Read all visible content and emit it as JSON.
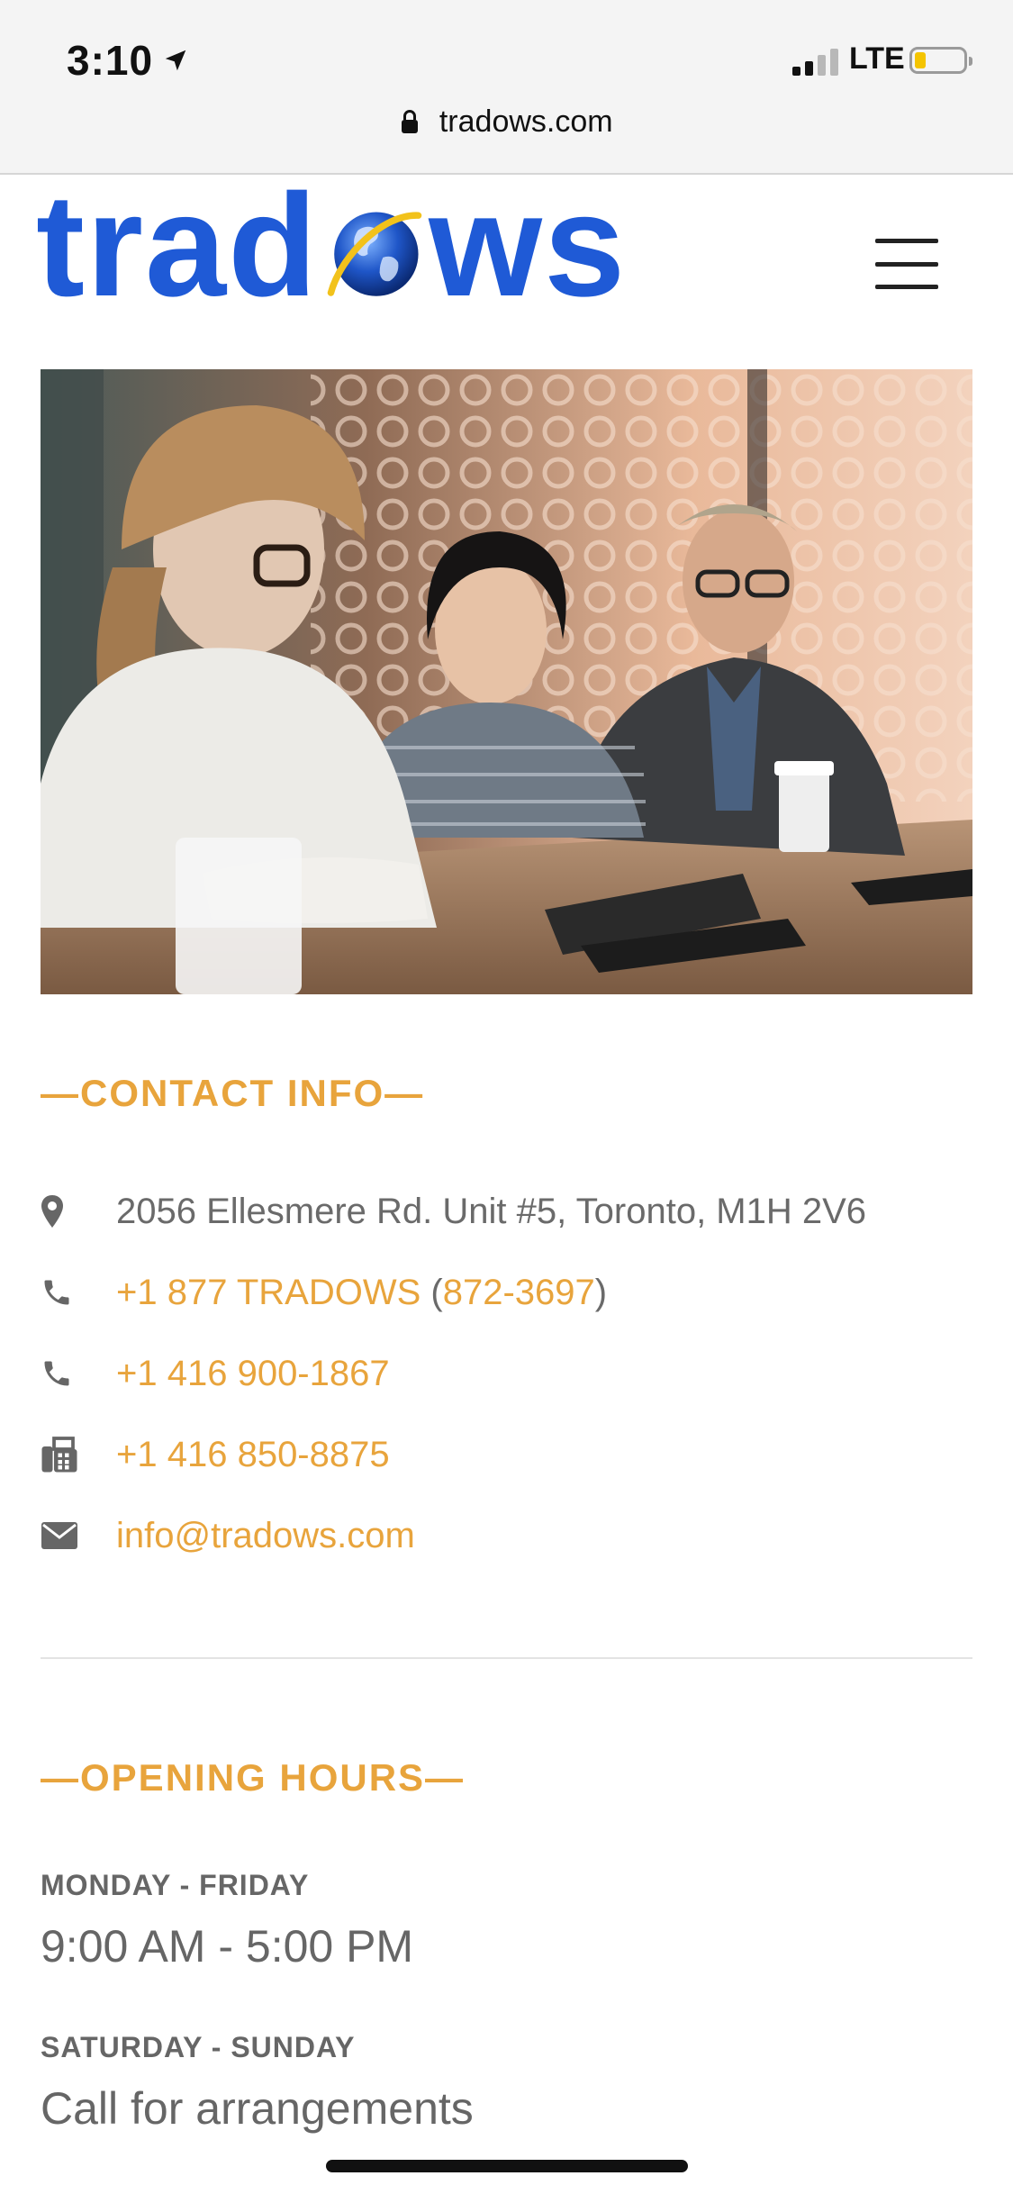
{
  "status_bar": {
    "time": "3:10",
    "carrier": "LTE"
  },
  "browser": {
    "url": "tradows.com"
  },
  "header": {
    "logo_prefix": "trad",
    "logo_suffix": "ws"
  },
  "contact": {
    "title": "—CONTACT INFO—",
    "address": "2056 Ellesmere Rd. Unit #5, Toronto, M1H 2V6",
    "phone1_text": "+1 877 TRADOWS",
    "phone1_open": " (",
    "phone1_num": "872-3697",
    "phone1_close": ")",
    "phone2": "+1 416 900-1867",
    "fax": "+1 416 850-8875",
    "email": "info@tradows.com"
  },
  "hours": {
    "title": "—OPENING HOURS—",
    "weekday_label": "MONDAY - FRIDAY",
    "weekday_value": "9:00 AM - 5:00 PM",
    "weekend_label": "SATURDAY - SUNDAY",
    "weekend_value": "Call for arrangements"
  },
  "colors": {
    "brand_blue": "#1f5ad6",
    "accent_orange": "#e8a43c"
  }
}
